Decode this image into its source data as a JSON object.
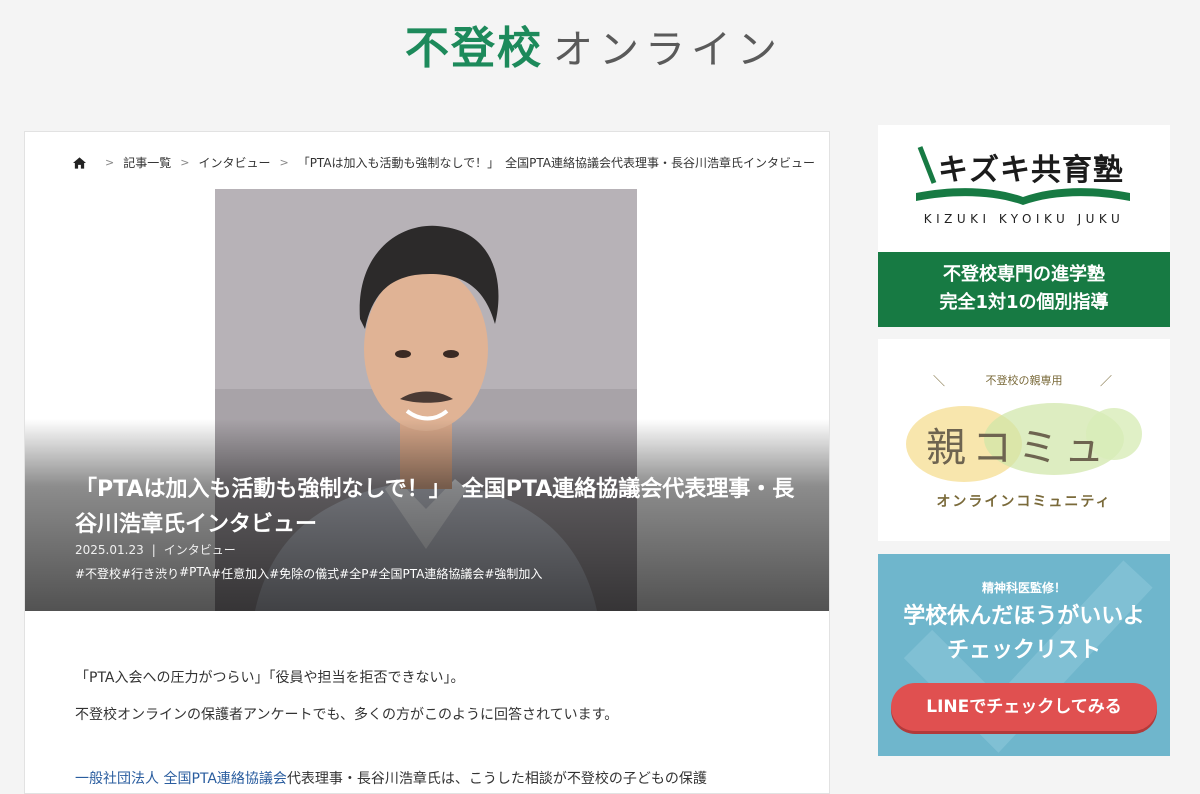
{
  "site": {
    "logo_main": "不登校",
    "logo_sub": "オンライン"
  },
  "breadcrumb": {
    "items": [
      "記事一覧",
      "インタビュー",
      "「PTAは加入も活動も強制なしで！」　全国PTA連絡協議会代表理事・長谷川浩章氏インタビュー"
    ]
  },
  "article": {
    "title": "「PTAは加入も活動も強制なしで！」　全国PTA連絡協議会代表理事・長谷川浩章氏インタビュー",
    "date": "2025.01.23",
    "meta_sep": "|",
    "category": "インタビュー",
    "tags": [
      "#不登校",
      "#行き渋り",
      "#PTA",
      "#任意加入",
      "#免除の儀式",
      "#全P",
      "#全国PTA連絡協議会",
      "#強制加入"
    ],
    "body": {
      "p1": "「PTA入会への圧力がつらい」「役員や担当を拒否できない」。",
      "p2": "不登校オンラインの保護者アンケートでも、多くの方がこのように回答されています。",
      "p3_link": "一般社団法人 全国PTA連絡協議会",
      "p3_text": "代表理事・長谷川浩章氏は、こうした相談が不登校の子どもの保護"
    }
  },
  "sidebar": {
    "kizuki": {
      "name": "キズキ共育塾",
      "roman": "KIZUKI KYOIKU JUKU",
      "line1": "不登校専門の進学塾",
      "line2": "完全1対1の個別指導",
      "colors": {
        "green": "#177a43"
      }
    },
    "oyakomyu": {
      "top": "不登校の親専用",
      "big": "親コミュ",
      "sub": "オンラインコミュニティ"
    },
    "checklist": {
      "small": "精神科医監修！",
      "line1": "学校休んだほうがいいよ",
      "line2": "チェックリスト",
      "button": "LINEでチェックしてみる",
      "colors": {
        "bg": "#6fb6cc",
        "button": "#e05050"
      }
    }
  }
}
